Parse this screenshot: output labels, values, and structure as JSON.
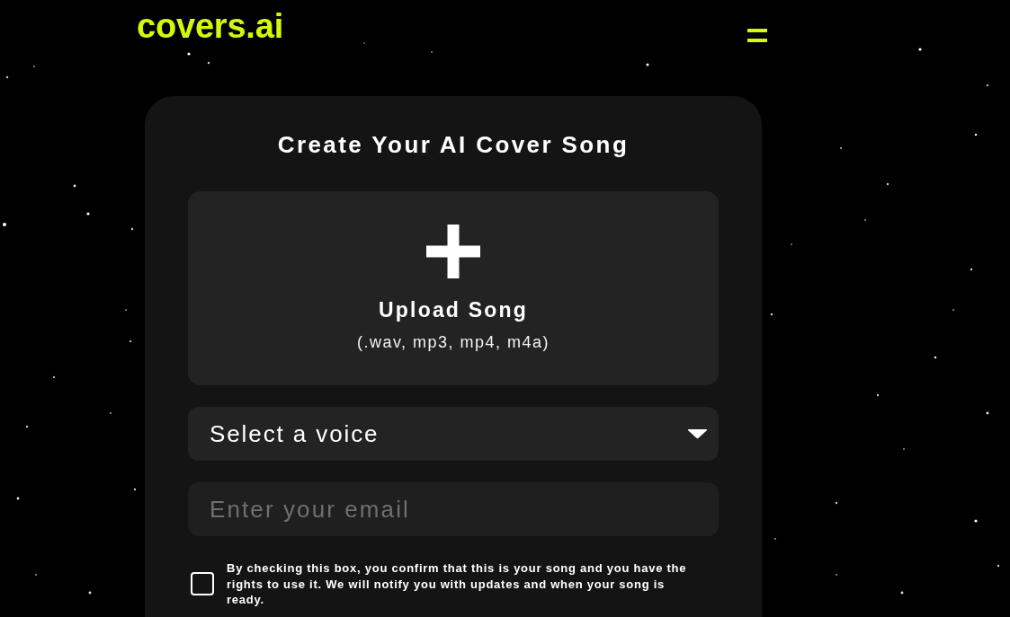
{
  "header": {
    "logo": "covers.ai"
  },
  "form": {
    "title": "Create Your AI Cover Song",
    "upload": {
      "label": "Upload Song",
      "formats": "(.wav, mp3, mp4, m4a)"
    },
    "voice_select": {
      "value": "Select a voice"
    },
    "email": {
      "placeholder": "Enter your email"
    },
    "consent": {
      "checked": false,
      "text": "By checking this box, you confirm that this is your song and you have the rights to use it. We will notify you with updates and when your song is ready."
    }
  }
}
